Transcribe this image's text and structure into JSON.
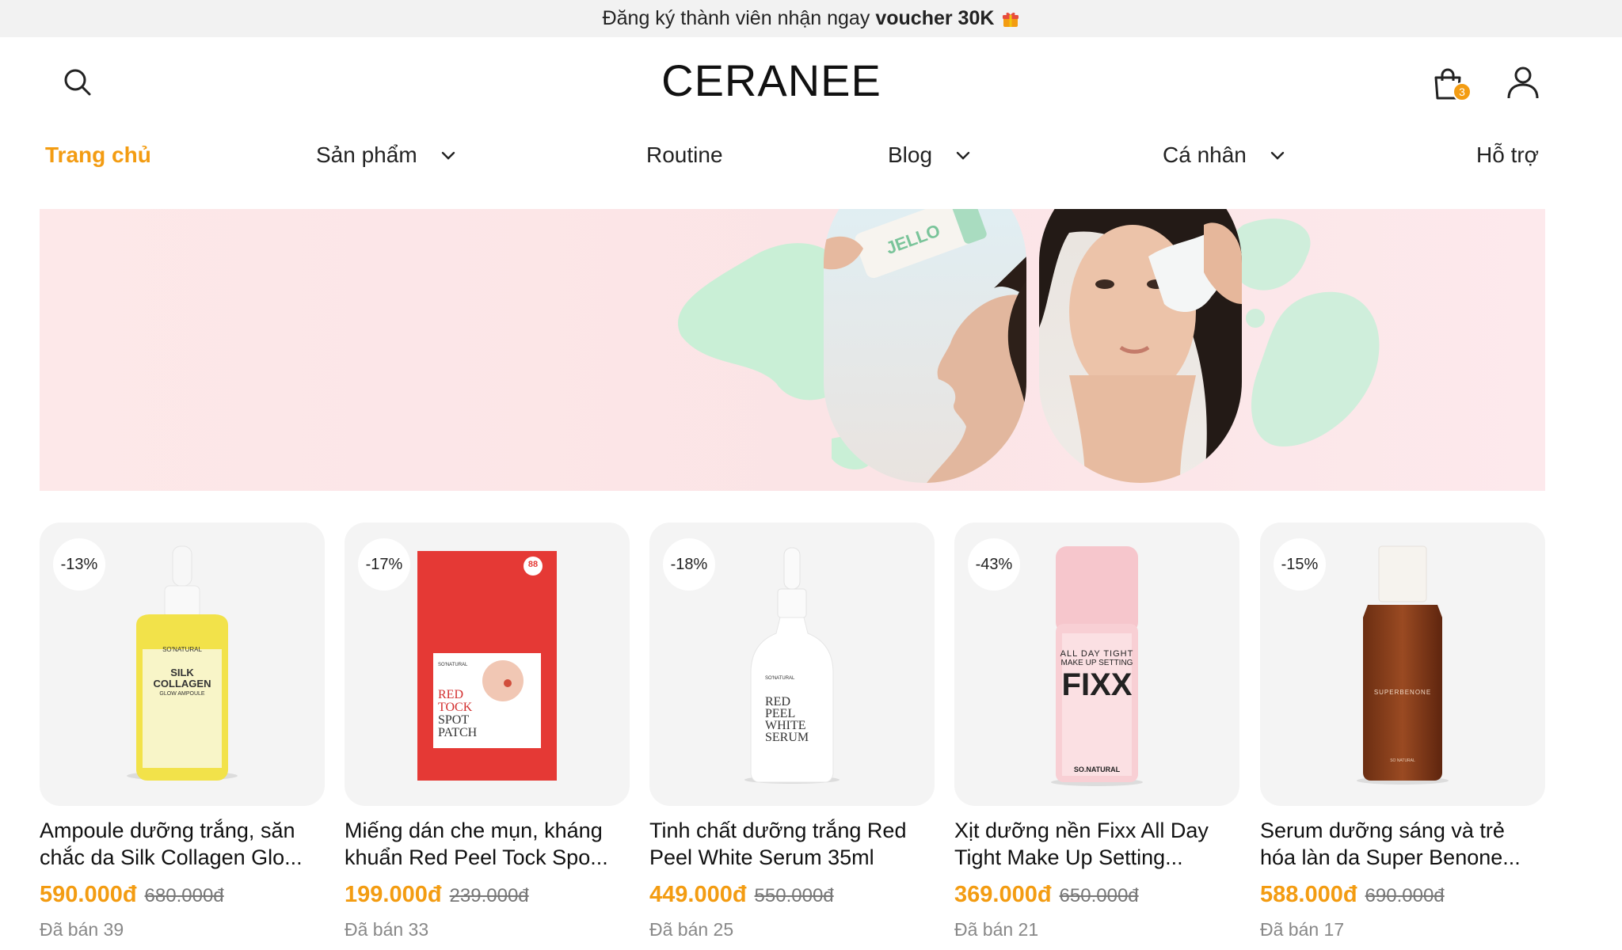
{
  "announcement": {
    "text": "Đăng ký thành viên nhận ngay",
    "highlight": "voucher 30K",
    "icon": "gift-icon"
  },
  "header": {
    "logo": "CERANEE",
    "cart_count": "3"
  },
  "nav": {
    "items": [
      {
        "label": "Trang chủ",
        "active": true,
        "has_dropdown": false
      },
      {
        "label": "Sản phẩm",
        "active": false,
        "has_dropdown": true
      },
      {
        "label": "Routine",
        "active": false,
        "has_dropdown": false
      },
      {
        "label": "Blog",
        "active": false,
        "has_dropdown": true
      },
      {
        "label": "Cá nhân",
        "active": false,
        "has_dropdown": true
      },
      {
        "label": "Hỗ trợ",
        "active": false,
        "has_dropdown": false
      }
    ]
  },
  "banner": {
    "product_labels": [
      "JELLO SKIN"
    ]
  },
  "products": [
    {
      "discount": "-13%",
      "title": "Ampoule dưỡng trắng, săn chắc da Silk Collagen Glo...",
      "price": "590.000đ",
      "old_price": "680.000đ",
      "sold": "Đã bán 39",
      "pack": [
        "SILK",
        "COLLAGEN",
        "GLOW AMPOULE"
      ],
      "brand": "SO'NATURAL"
    },
    {
      "discount": "-17%",
      "title": "Miếng dán che mụn, kháng khuẩn Red Peel Tock Spo...",
      "price": "199.000đ",
      "old_price": "239.000đ",
      "sold": "Đã bán 33",
      "pack": [
        "RED",
        "TOCK",
        "SPOT",
        "PATCH"
      ],
      "brand": "SO'NATURAL",
      "badge": "88"
    },
    {
      "discount": "-18%",
      "title": "Tinh chất dưỡng trắng Red Peel White Serum 35ml",
      "price": "449.000đ",
      "old_price": "550.000đ",
      "sold": "Đã bán 25",
      "pack": [
        "RED",
        "PEEL",
        "WHITE",
        "SERUM"
      ],
      "brand": "SO'NATURAL"
    },
    {
      "discount": "-43%",
      "title": "Xịt dưỡng nền Fixx All Day Tight Make Up Setting...",
      "price": "369.000đ",
      "old_price": "650.000đ",
      "sold": "Đã bán 21",
      "pack": [
        "ALL DAY TIGHT",
        "MAKE UP SETTING",
        "FIXX"
      ],
      "brand": "SO.NATURAL"
    },
    {
      "discount": "-15%",
      "title": "Serum dưỡng sáng và trẻ hóa làn da Super Benone...",
      "price": "588.000đ",
      "old_price": "690.000đ",
      "sold": "Đã bán 17",
      "pack": [
        "SUPERBENONE"
      ],
      "brand": "SO NATURAL"
    }
  ],
  "colors": {
    "accent": "#f39c12",
    "banner_bg": "#fbe4e6",
    "blob_green": "#c9efd6",
    "card_bg": "#f4f4f4"
  }
}
